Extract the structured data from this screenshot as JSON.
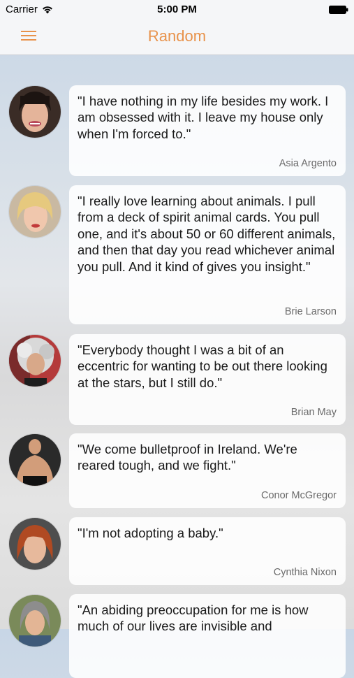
{
  "status_bar": {
    "carrier": "Carrier",
    "time": "5:00 PM"
  },
  "nav": {
    "title": "Random",
    "accent_color": "#e8924a"
  },
  "quotes": [
    {
      "text": "\"I have nothing in my life besides my work. I am obsessed with it. I leave my house only when I'm forced to.\"",
      "author": "Asia Argento"
    },
    {
      "text": "\"I really love learning about animals. I pull from a deck of spirit animal cards. You pull one, and it's about 50 or 60 different animals, and then that day you read whichever animal you pull. And it kind of gives you insight.\"",
      "author": "Brie Larson"
    },
    {
      "text": "\"Everybody thought I was a bit of an eccentric for wanting to be out there looking at the stars, but I still do.\"",
      "author": "Brian May"
    },
    {
      "text": "\"We come bulletproof in Ireland. We're reared tough, and we fight.\"",
      "author": "Conor McGregor"
    },
    {
      "text": "\"I'm not adopting a baby.\"",
      "author": "Cynthia Nixon"
    },
    {
      "text": "\"An abiding preoccupation for me is how much of our lives are invisible and",
      "author": ""
    }
  ]
}
